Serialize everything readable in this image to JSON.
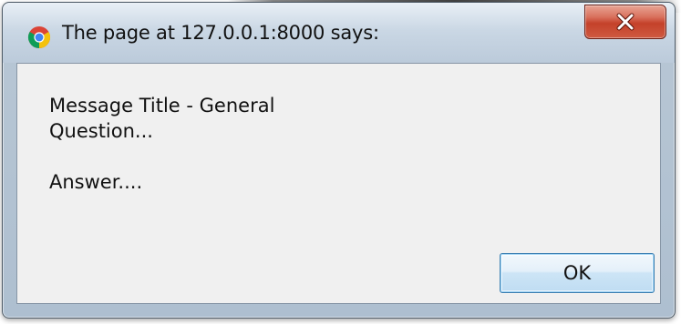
{
  "dialog": {
    "title": "The page at 127.0.0.1:8000 says:",
    "app_icon": "chrome-icon",
    "close_icon": "close-icon",
    "message_lines": [
      "Message Title - General",
      "Question..."
    ],
    "answer_line": "Answer....",
    "ok_label": "OK"
  },
  "colors": {
    "close_button": "#c7432b",
    "ok_border": "#3c7fb1",
    "client_background": "#f0f0f0"
  }
}
